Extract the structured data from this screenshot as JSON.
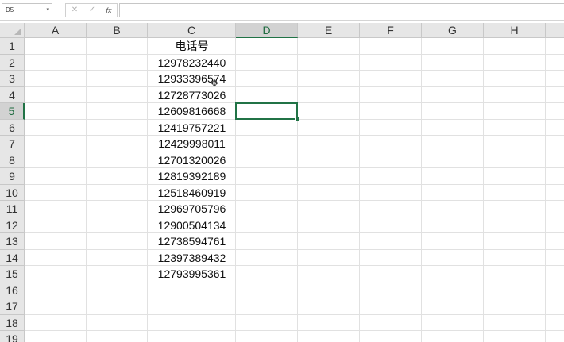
{
  "formula_bar": {
    "name_box": "D5",
    "cancel_icon": "✕",
    "confirm_icon": "✓",
    "fx_label": "fx",
    "formula": ""
  },
  "columns": [
    "A",
    "B",
    "C",
    "D",
    "E",
    "F",
    "G",
    "H"
  ],
  "active_column": "D",
  "rows": [
    "1",
    "2",
    "3",
    "4",
    "5",
    "6",
    "7",
    "8",
    "9",
    "10",
    "11",
    "12",
    "13",
    "14",
    "15",
    "16",
    "17",
    "18",
    "19"
  ],
  "active_row": "5",
  "column_c_values": [
    "电话号",
    "12978232440",
    "12933396574",
    "12728773026",
    "12609816668",
    "12419757221",
    "12429998011",
    "12701320026",
    "12819392189",
    "12518460919",
    "12969705796",
    "12900504134",
    "12738594761",
    "12397389432",
    "12793995361"
  ],
  "accent_color": "#217346"
}
